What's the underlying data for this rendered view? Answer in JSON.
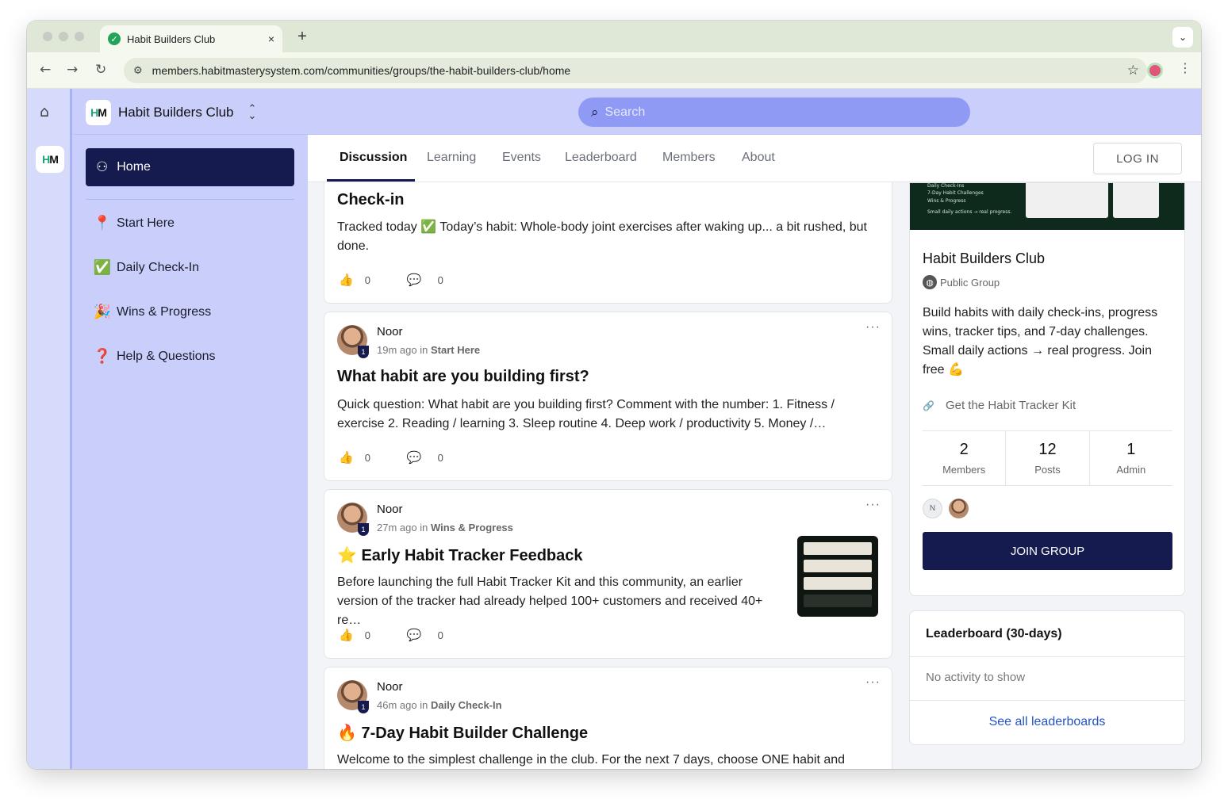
{
  "browser": {
    "tab_title": "Habit Builders Club",
    "tab_close": "×",
    "new_tab": "+",
    "url": "members.habitmasterysystem.com/communities/groups/the-habit-builders-club/home"
  },
  "app": {
    "logo_h": "H",
    "logo_m": "M",
    "group_name": "Habit Builders Club",
    "search_placeholder": "Search"
  },
  "sidebar": {
    "home_label": "Home",
    "items": [
      {
        "emoji": "📍",
        "label": "Start Here"
      },
      {
        "emoji": "✅",
        "label": "Daily Check-In"
      },
      {
        "emoji": "🎉",
        "label": "Wins & Progress"
      },
      {
        "emoji": "❓",
        "label": "Help & Questions"
      }
    ]
  },
  "page_tabs": [
    "Discussion",
    "Learning",
    "Events",
    "Leaderboard",
    "Members",
    "About"
  ],
  "login_label": "LOG IN",
  "feed": {
    "partial_post": {
      "title": "Check-in",
      "body": "Tracked today ✅ Today’s habit: Whole-body joint exercises after waking up... a bit rushed, but done.",
      "likes": "0",
      "comments": "0"
    },
    "posts": [
      {
        "author": "Noor",
        "badge": "1",
        "time": "19m ago",
        "in_word": "in",
        "category": "Start Here",
        "title": "What habit are you building first?",
        "body": "Quick question: What habit are you building first? Comment with the number: 1. Fitness / exercise 2. Reading / learning 3. Sleep routine 4. Deep work / productivity 5. Money /…",
        "likes": "0",
        "comments": "0"
      },
      {
        "author": "Noor",
        "badge": "1",
        "time": "27m ago",
        "in_word": "in",
        "category": "Wins & Progress",
        "title": "⭐ Early Habit Tracker Feedback",
        "body": "Before launching the full Habit Tracker Kit and this community, an earlier version of the tracker had already helped 100+ customers and received 40+ re…",
        "likes": "0",
        "comments": "0"
      },
      {
        "author": "Noor",
        "badge": "1",
        "time": "46m ago",
        "in_word": "in",
        "category": "Daily Check-In",
        "title": "🔥 7-Day Habit Builder Challenge",
        "body": "Welcome to the simplest challenge in the club. For the next 7 days, choose ONE habit and"
      }
    ]
  },
  "group": {
    "banner_lines": [
      "Daily Check-Ins",
      "7-Day Habit Challenges",
      "Wins & Progress",
      "Small daily actions → real progress."
    ],
    "name": "Habit Builders Club",
    "type": "Public Group",
    "description": "Build habits with daily check-ins, progress wins, tracker tips, and 7-day challenges. Small daily actions → real progress. Join free 💪",
    "link_label": "Get the Habit Tracker Kit",
    "stats": [
      {
        "value": "2",
        "label": "Members"
      },
      {
        "value": "12",
        "label": "Posts"
      },
      {
        "value": "1",
        "label": "Admin"
      }
    ],
    "member_initial": "N",
    "join_label": "JOIN GROUP"
  },
  "leaderboard": {
    "title": "Leaderboard (30-days)",
    "empty": "No activity to show",
    "see_all": "See all leaderboards"
  },
  "colors": {
    "brand_navy": "#151b4e",
    "sidebar_lavender": "#c9cffa",
    "search_fill": "#8f9af4",
    "link_blue": "#2452c8"
  }
}
